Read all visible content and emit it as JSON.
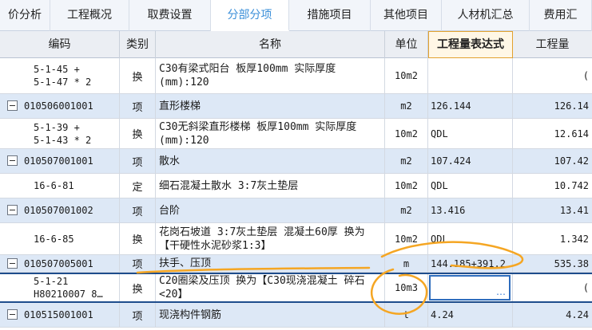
{
  "tabs": [
    {
      "label": "价分析"
    },
    {
      "label": "工程概况"
    },
    {
      "label": "取费设置"
    },
    {
      "label": "分部分项"
    },
    {
      "label": "措施项目"
    },
    {
      "label": "其他项目"
    },
    {
      "label": "人材机汇总"
    },
    {
      "label": "费用汇"
    }
  ],
  "active_tab": "分部分项",
  "columns": {
    "code": "编码",
    "type": "类别",
    "name": "名称",
    "unit": "单位",
    "expr": "工程量表达式",
    "qty": "工程量"
  },
  "rows": [
    {
      "code1": "5-1-45 +",
      "code2": "5-1-47 * 2",
      "type": "换",
      "name": "C30有梁式阳台 板厚100mm  实际厚度(mm):120",
      "unit": "10m2",
      "expr": "",
      "qty": "("
    },
    {
      "code1": "010506001001",
      "code2": "",
      "type": "项",
      "name": "直形楼梯",
      "unit": "m2",
      "expr": "126.144",
      "qty": "126.14"
    },
    {
      "code1": "5-1-39 +",
      "code2": "5-1-43 * 2",
      "type": "换",
      "name": "C30无斜梁直形楼梯 板厚100mm  实际厚度(mm):120",
      "unit": "10m2",
      "expr": "QDL",
      "qty": "12.614"
    },
    {
      "code1": "010507001001",
      "code2": "",
      "type": "项",
      "name": "散水",
      "unit": "m2",
      "expr": "107.424",
      "qty": "107.42"
    },
    {
      "code1": "16-6-81",
      "code2": "",
      "type": "定",
      "name": "细石混凝土散水 3:7灰土垫层",
      "unit": "10m2",
      "expr": "QDL",
      "qty": "10.742"
    },
    {
      "code1": "010507001002",
      "code2": "",
      "type": "项",
      "name": "台阶",
      "unit": "m2",
      "expr": "13.416",
      "qty": "13.41"
    },
    {
      "code1": "16-6-85",
      "code2": "",
      "type": "换",
      "name": "花岗石坡道 3:7灰土垫层 混凝土60厚  换为【干硬性水泥砂浆1:3】",
      "unit": "10m2",
      "expr": "QDL",
      "qty": "1.342"
    },
    {
      "code1": "010507005001",
      "code2": "",
      "type": "项",
      "name": "扶手、压顶",
      "unit": "m",
      "expr": "144.185+391.2",
      "qty": "535.38"
    },
    {
      "code1": "5-1-21",
      "code2": "H80210007 8…",
      "type": "换",
      "name": "C20圈梁及压顶  换为【C30现浇混凝土 碎石<20】",
      "unit": "10m3",
      "expr": "",
      "qty": "("
    },
    {
      "code1": "010515001001",
      "code2": "",
      "type": "项",
      "name": "现浇构件钢筋",
      "unit": "t",
      "expr": "4.24",
      "qty": "4.24"
    }
  ],
  "edit_button_label": "…",
  "colors": {
    "accent": "#3b8fd9",
    "row_highlight": "#dde8f6",
    "annotation": "#f5a623",
    "selection": "#1e4d8c"
  },
  "icons": {
    "collapse": "minus-box-icon",
    "more": "ellipsis-icon"
  }
}
